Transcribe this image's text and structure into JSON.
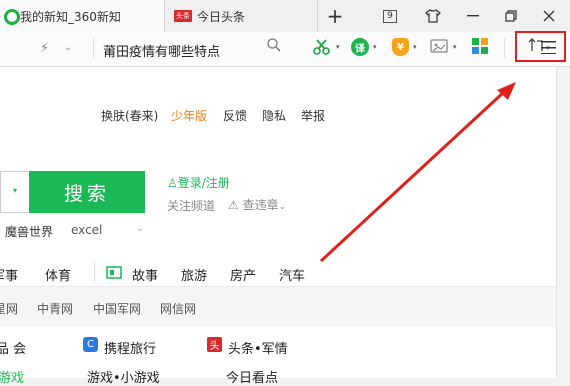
{
  "tabs": [
    {
      "label": "我的新知_360新知"
    },
    {
      "badge": "头条",
      "label": "今日头条"
    }
  ],
  "tabbar": {
    "new_tab": "+",
    "tab_count": "9"
  },
  "address": {
    "text": "莆田疫情有哪些特点"
  },
  "toplinks": [
    {
      "label": "换肤(春来)"
    },
    {
      "label": "少年版",
      "color": "#f07d17"
    },
    {
      "label": "反馈"
    },
    {
      "label": "隐私"
    },
    {
      "label": "举报"
    }
  ],
  "search": {
    "button": "搜索",
    "login": "登录/注册",
    "follow": "关注频道",
    "violation": "查违章",
    "suggest1": "魔兽世界",
    "suggest2": "excel"
  },
  "nav": {
    "items": [
      "军事",
      "体育",
      "故事",
      "旅游",
      "房产",
      "汽车"
    ]
  },
  "sites": [
    "環球网",
    "中青网",
    "中国军网",
    "网信网"
  ],
  "sites_shown": [
    "星网",
    "中青网",
    "中国军网",
    "网信网"
  ],
  "rows": {
    "r1": [
      "品 会",
      "携程旅行",
      "头条•军情"
    ],
    "r2": [
      "游戏",
      "游戏•小游戏",
      "今日看点"
    ]
  },
  "colors": {
    "brand_green": "#19b955",
    "highlight_red": "#e0201a"
  }
}
